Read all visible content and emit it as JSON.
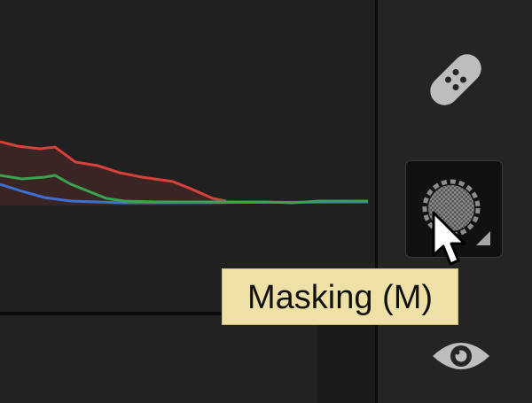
{
  "histogram": {
    "colors": {
      "red": "#d8403a",
      "green": "#3aa34f",
      "blue": "#3d6fd1",
      "fill": "#3a2524"
    }
  },
  "toolstrip": {
    "tools": [
      {
        "name": "healing",
        "icon": "bandage-icon",
        "selected": false
      },
      {
        "name": "masking",
        "icon": "masking-icon",
        "selected": true
      },
      {
        "name": "red-eye",
        "icon": "eye-icon",
        "selected": false
      }
    ]
  },
  "tooltip": {
    "text": "Masking (M)",
    "background": "#efe1a5"
  },
  "cursor": {
    "icon": "arrow-cursor-icon"
  }
}
